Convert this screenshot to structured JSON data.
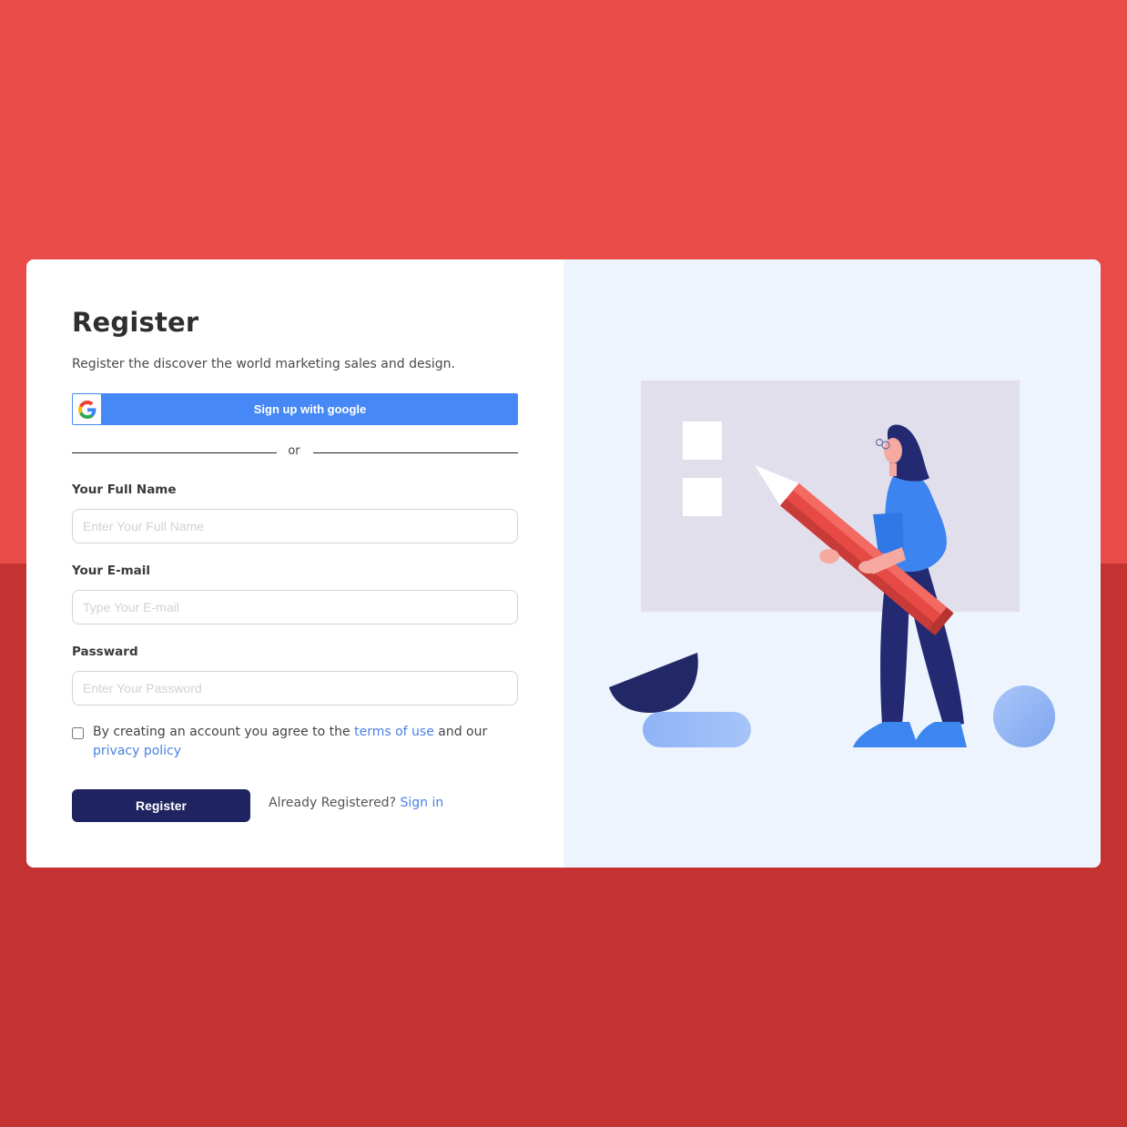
{
  "form": {
    "title": "Register",
    "subtitle": "Register the discover the world marketing sales and design.",
    "google_button_label": "Sign up with google",
    "divider_text": "or",
    "full_name": {
      "label": "Your Full Name",
      "placeholder": "Enter Your Full Name",
      "value": ""
    },
    "email": {
      "label": "Your E-mail",
      "placeholder": "Type Your E-mail",
      "value": ""
    },
    "password": {
      "label": "Passward",
      "placeholder": "Enter Your Password",
      "value": ""
    },
    "agreement": {
      "checked": false,
      "text_before": "By creating an account you agree to the",
      "terms_link": "terms of use",
      "text_middle": "and our",
      "privacy_link": "privacy policy"
    },
    "register_button_label": "Register",
    "already_registered_text": "Already Registered?",
    "sign_in_link": "Sign in"
  },
  "icons": {
    "google": "google-g-icon",
    "illustration": "woman-holding-pencil-illustration"
  },
  "colors": {
    "background_top": "#e94b48",
    "background_bottom": "#c53232",
    "google_button": "#4689f6",
    "register_button": "#1f2360",
    "link": "#4a82e4",
    "illustration_panel": "#edf4fe"
  }
}
